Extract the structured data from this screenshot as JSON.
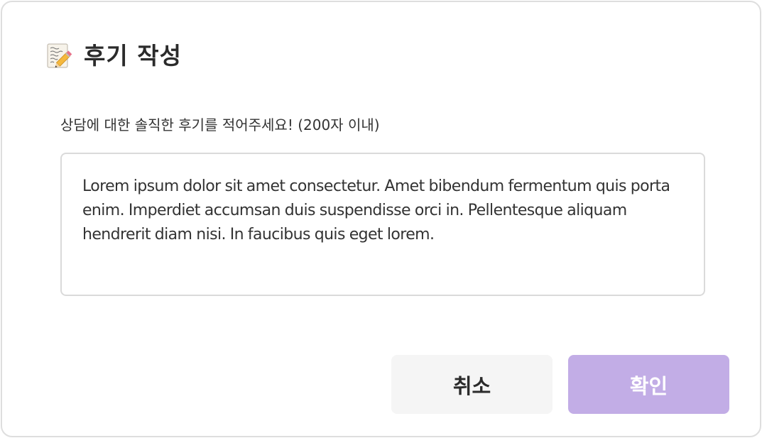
{
  "modal": {
    "title": "후기 작성",
    "title_icon": "memo-pencil-icon",
    "description": "상담에 대한 솔직한 후기를 적어주세요! (200자 이내)",
    "review": {
      "value": "Lorem ipsum dolor sit amet consectetur. Amet bibendum fermentum quis porta enim. Imperdiet accumsan duis suspendisse orci in. Pellentesque aliquam hendrerit diam nisi. In faucibus quis eget lorem."
    },
    "buttons": {
      "cancel_label": "취소",
      "confirm_label": "확인"
    }
  },
  "colors": {
    "confirm_bg": "#c2ade6",
    "cancel_bg": "#f5f5f5",
    "border": "#dadada"
  }
}
